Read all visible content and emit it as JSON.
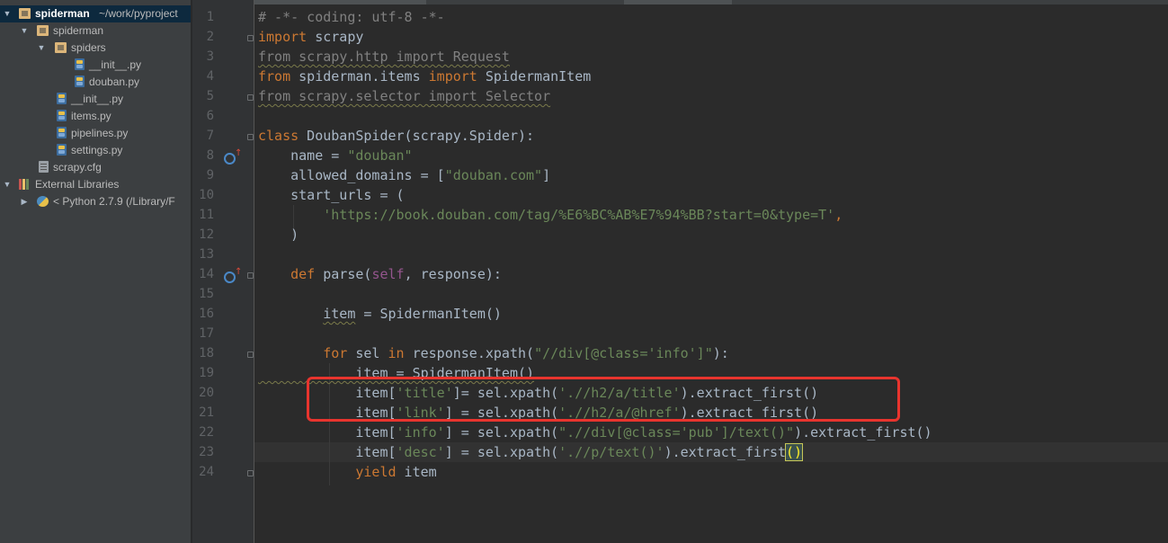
{
  "project": {
    "root_name": "spiderman",
    "root_path": "~/work/pyproject",
    "tree": [
      {
        "label": "spiderman",
        "kind": "folder"
      },
      {
        "label": "spiders",
        "kind": "folder"
      },
      {
        "label": "__init__.py",
        "kind": "py"
      },
      {
        "label": "douban.py",
        "kind": "py"
      },
      {
        "label": "__init__.py",
        "kind": "py"
      },
      {
        "label": "items.py",
        "kind": "py"
      },
      {
        "label": "pipelines.py",
        "kind": "py"
      },
      {
        "label": "settings.py",
        "kind": "py"
      },
      {
        "label": "scrapy.cfg",
        "kind": "cfg"
      }
    ],
    "external_libraries": "External Libraries",
    "python_sdk": "< Python 2.7.9 (/Library/F"
  },
  "editor": {
    "line_numbers": [
      "1",
      "2",
      "3",
      "4",
      "5",
      "6",
      "7",
      "8",
      "9",
      "10",
      "11",
      "12",
      "13",
      "14",
      "15",
      "16",
      "17",
      "18",
      "19",
      "20",
      "21",
      "22",
      "23",
      "24"
    ],
    "lines": {
      "l1": "# -*- coding: utf-8 -*-",
      "l2_kw": "import",
      "l2_rest": " scrapy",
      "l3": "from scrapy.http import Request",
      "l4_from": "from",
      "l4_mod": " spiderman.items ",
      "l4_import": "import",
      "l4_name": " SpidermanItem",
      "l5": "from scrapy.selector import Selector",
      "l7_kw": "class",
      "l7_rest": " DoubanSpider(scrapy.Spider):",
      "l8_a": "    name = ",
      "l8_s": "\"douban\"",
      "l9_a": "    allowed_domains = [",
      "l9_s": "\"douban.com\"",
      "l9_b": "]",
      "l10": "    start_urls = (",
      "l11_a": "        ",
      "l11_s": "'https://book.douban.com/tag/%E6%BC%AB%E7%94%BB?start=0&type=T'",
      "l11_b": ",",
      "l12": "    )",
      "l14_a": "    ",
      "l14_kw": "def",
      "l14_b": " parse(",
      "l14_self": "self",
      "l14_c": ", response):",
      "l16_a": "        ",
      "l16_item": "item",
      "l16_b": " = SpidermanItem()",
      "l18_a": "        ",
      "l18_for": "for",
      "l18_b": " sel ",
      "l18_in": "in",
      "l18_c": " response.xpath(",
      "l18_s": "\"//div[@class='info']\"",
      "l18_d": "):",
      "l19": "            item = SpidermanItem()",
      "l20_a": "            item[",
      "l20_s1": "'title'",
      "l20_b": "]= sel.xpath(",
      "l20_s2": "'.//h2/a/title'",
      "l20_c": ").extract_first()",
      "l21_a": "            item[",
      "l21_s1": "'link'",
      "l21_b": "] = sel.xpath(",
      "l21_s2": "'.//h2/a/@href'",
      "l21_c": ").extract_first()",
      "l22_a": "            item[",
      "l22_s1": "'info'",
      "l22_b": "] = sel.xpath(",
      "l22_s2": "\".//div[@class='pub']/text()\"",
      "l22_c": ").extract_first()",
      "l23_a": "            item[",
      "l23_s1": "'desc'",
      "l23_b": "] = sel.xpath(",
      "l23_s2": "'.//p/text()'",
      "l23_c": ").extract_first",
      "l23_p": "()",
      "l24_a": "            ",
      "l24_kw": "yield",
      "l24_b": " item"
    }
  },
  "colors": {
    "keyword": "#cc7832",
    "string": "#6a8759",
    "comment": "#808080",
    "default": "#a9b7c6",
    "annotation_box": "#e8342e"
  }
}
